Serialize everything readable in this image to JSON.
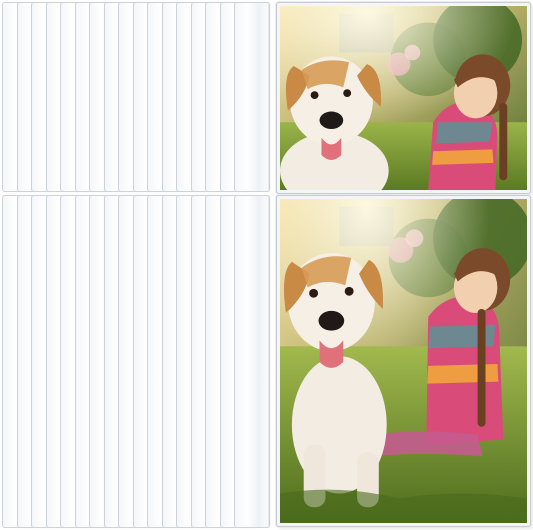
{
  "image": {
    "subject": "photo-sleeve-product",
    "colors": {
      "background": "#ffffff",
      "sleeve_edge": "#cdd3d9",
      "grass": "#6f8f2a",
      "dog_coat": "#f3ece2",
      "dog_patch": "#c98a45",
      "girl_hair": "#7a4a2a",
      "dress": "#d94c7a"
    }
  }
}
